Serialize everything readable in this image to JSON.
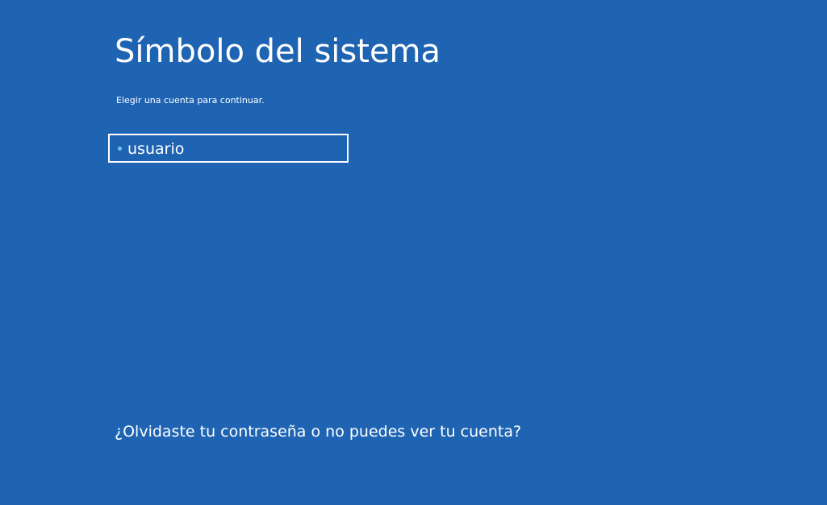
{
  "page": {
    "title": "Símbolo del sistema",
    "subtitle": "Elegir una cuenta para continuar.",
    "background_color": "#1f64b2",
    "accent_color": "#6ec8f5"
  },
  "accounts": [
    {
      "name": "usuario",
      "bullet_icon": "bullet-icon"
    }
  ],
  "links": {
    "forgot": "¿Olvidaste tu contraseña o no puedes ver tu cuenta?"
  }
}
